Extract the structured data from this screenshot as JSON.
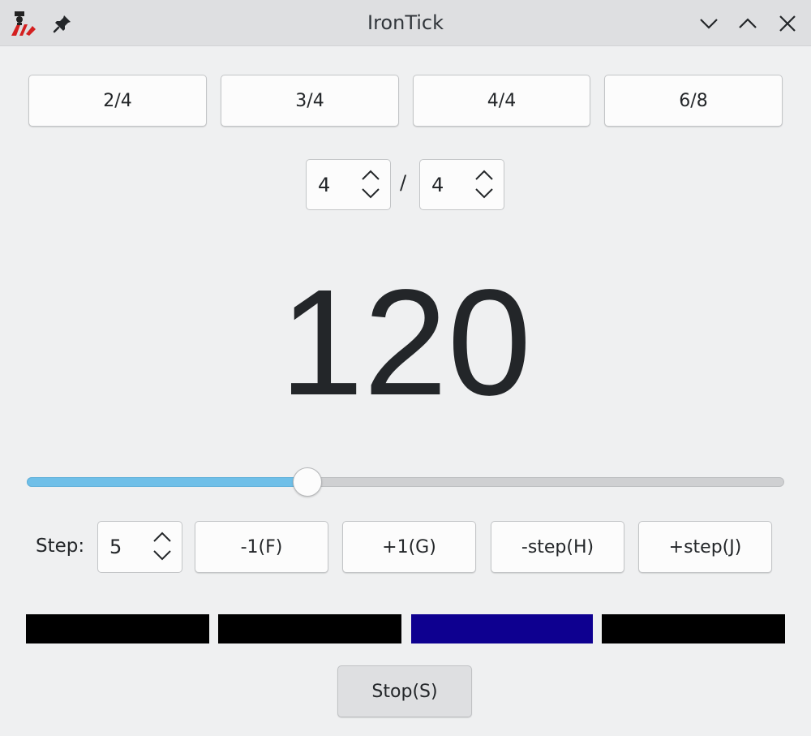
{
  "window": {
    "title": "IronTick"
  },
  "presets": [
    {
      "label": "2/4"
    },
    {
      "label": "3/4"
    },
    {
      "label": "4/4"
    },
    {
      "label": "6/8"
    }
  ],
  "time_signature": {
    "numerator": "4",
    "separator": "/",
    "denominator": "4"
  },
  "tempo": {
    "bpm": "120",
    "slider_fraction": 0.37
  },
  "step": {
    "label": "Step:",
    "value": "5"
  },
  "controls": {
    "minus_one": "-1(F)",
    "plus_one": "+1(G)",
    "minus_step": "-step(H)",
    "plus_step": "+step(J)"
  },
  "beats": [
    {
      "color": "#000000",
      "active": false
    },
    {
      "color": "#000000",
      "active": false
    },
    {
      "color": "#0e0090",
      "active": true
    },
    {
      "color": "#000000",
      "active": false
    }
  ],
  "stop_button": {
    "label": "Stop(S)"
  },
  "colors": {
    "accent": "#6fbfe8",
    "active_beat": "#0e0090",
    "inactive_beat": "#000000"
  }
}
